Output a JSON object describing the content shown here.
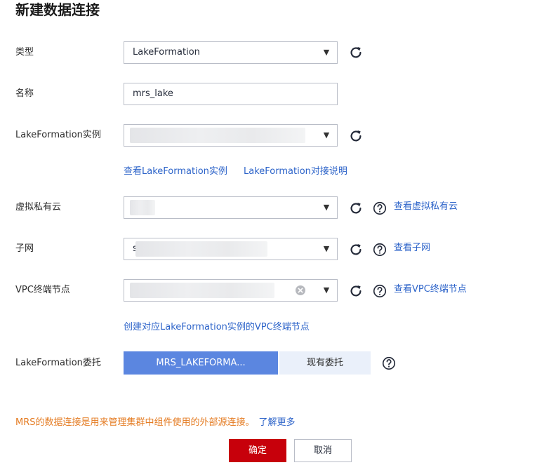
{
  "dialog": {
    "title": "新建数据连接"
  },
  "fields": {
    "type": {
      "label": "类型",
      "value": "LakeFormation"
    },
    "name": {
      "label": "名称",
      "value": "mrs_lake"
    },
    "instance": {
      "label": "LakeFormation实例",
      "links": [
        "查看LakeFormation实例",
        "LakeFormation对接说明"
      ]
    },
    "vpc": {
      "label": "虚拟私有云",
      "link": "查看虚拟私有云"
    },
    "subnet": {
      "label": "子网",
      "value_prefix": "s",
      "link": "查看子网"
    },
    "endpoint": {
      "label": "VPC终端节点",
      "link": "查看VPC终端节点",
      "create_link": "创建对应LakeFormation实例的VPC终端节点"
    },
    "agency": {
      "label": "LakeFormation委托",
      "options": [
        "MRS_LAKEFORMA...",
        "现有委托"
      ],
      "selected": "MRS_LAKEFORMA..."
    }
  },
  "footer": {
    "notice": "MRS的数据连接是用来管理集群中组件使用的外部源连接。",
    "learn_more": "了解更多",
    "ok_label": "确定",
    "cancel_label": "取消"
  },
  "icons": {
    "refresh": "refresh-icon",
    "help": "help-icon",
    "dropdown": "caret-down-icon",
    "clear": "clear-icon"
  },
  "colors": {
    "primary": "#c7000b",
    "link": "#2c63c9",
    "segment_active": "#5b86e0",
    "segment_inactive": "#eaf0fa",
    "warning": "#e47a20"
  }
}
